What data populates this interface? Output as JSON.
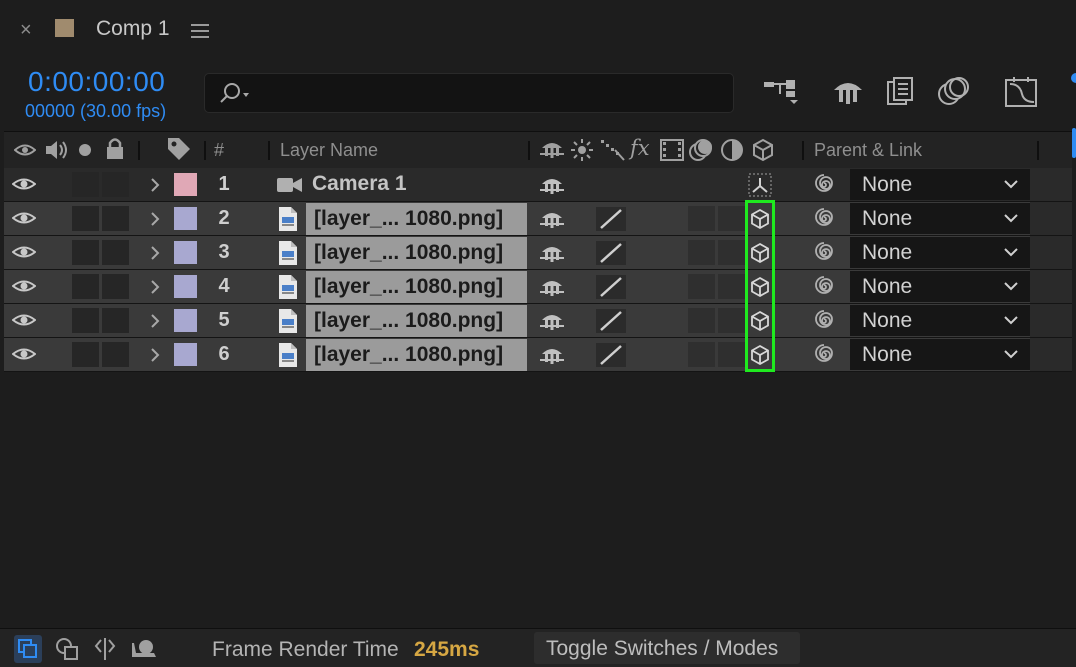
{
  "tab": {
    "close": "×",
    "title": "Comp 1"
  },
  "time": {
    "timecode": "0:00:00:00",
    "frames": "00000 (30.00 fps)"
  },
  "search": {
    "placeholder": ""
  },
  "columns": {
    "number": "#",
    "layer_name": "Layer Name",
    "parent_link": "Parent & Link"
  },
  "layers": [
    {
      "num": "1",
      "name": "Camera 1",
      "type": "camera",
      "label_color": "#e0a8b6",
      "parent": "None"
    },
    {
      "num": "2",
      "name": "[layer_... 1080.png]",
      "type": "image",
      "label_color": "#a8a8d0",
      "parent": "None"
    },
    {
      "num": "3",
      "name": "[layer_... 1080.png]",
      "type": "image",
      "label_color": "#a8a8d0",
      "parent": "None"
    },
    {
      "num": "4",
      "name": "[layer_... 1080.png]",
      "type": "image",
      "label_color": "#a8a8d0",
      "parent": "None"
    },
    {
      "num": "5",
      "name": "[layer_... 1080.png]",
      "type": "image",
      "label_color": "#a8a8d0",
      "parent": "None"
    },
    {
      "num": "6",
      "name": "[layer_... 1080.png]",
      "type": "image",
      "label_color": "#a8a8d0",
      "parent": "None"
    }
  ],
  "footer": {
    "frame_render_label": "Frame Render Time",
    "frame_render_value": "245ms",
    "toggle_label": "Toggle Switches / Modes"
  },
  "colors": {
    "accent": "#2f8cf4",
    "highlight": "#1fea1f",
    "render_time": "#d6a743"
  }
}
